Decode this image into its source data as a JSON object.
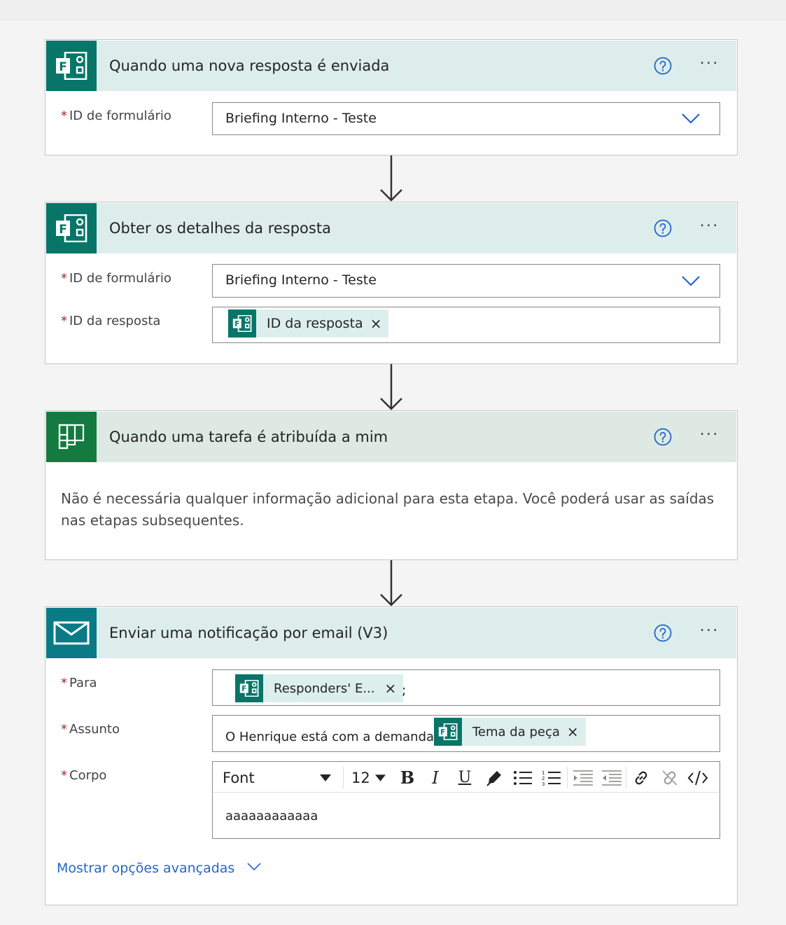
{
  "colors": {
    "forms_teal": "#077568",
    "planner_green": "#137a40",
    "mail_teal": "#0a7b86",
    "header_teal_bg": "#dcedec",
    "header_green_bg": "#dde9e2",
    "link_blue": "#2266cc",
    "required_red": "#a4262c"
  },
  "cards": {
    "trigger_form": {
      "icon": "microsoft-forms-icon",
      "title": "Quando uma nova resposta é enviada",
      "fields": {
        "form_id_label": "ID de formulário",
        "form_id_value": "Briefing Interno - Teste"
      }
    },
    "get_details": {
      "icon": "microsoft-forms-icon",
      "title": "Obter os detalhes da resposta",
      "fields": {
        "form_id_label": "ID de formulário",
        "form_id_value": "Briefing Interno - Teste",
        "response_id_label": "ID da resposta",
        "response_id_token": "ID da resposta"
      }
    },
    "planner": {
      "icon": "planner-icon",
      "title": "Quando uma tarefa é atribuída a mim",
      "description": "Não é necessária qualquer informação adicional para esta etapa. Você poderá usar as saídas nas etapas subsequentes."
    },
    "email": {
      "icon": "mail-icon",
      "title": "Enviar uma notificação por email (V3)",
      "fields": {
        "to_label": "Para",
        "to_token": "Responders' E...",
        "to_suffix": ";",
        "subject_label": "Assunto",
        "subject_text": "O Henrique está com a demanda",
        "subject_token": "Tema da peça",
        "body_label": "Corpo",
        "body_text": "aaaaaaaaaaaa"
      },
      "editor": {
        "font_select": "Font",
        "size_select": "12",
        "tools": [
          "bold-icon",
          "italic-icon",
          "underline-icon",
          "highlight-pen-icon",
          "bulleted-list-icon",
          "numbered-list-icon",
          "decrease-indent-icon",
          "increase-indent-icon",
          "link-icon",
          "unlink-icon",
          "code-view-icon"
        ]
      },
      "advanced_link": "Mostrar opções avançadas"
    }
  },
  "required_marker": "*",
  "remove_glyph": "×",
  "more_glyph": "···"
}
